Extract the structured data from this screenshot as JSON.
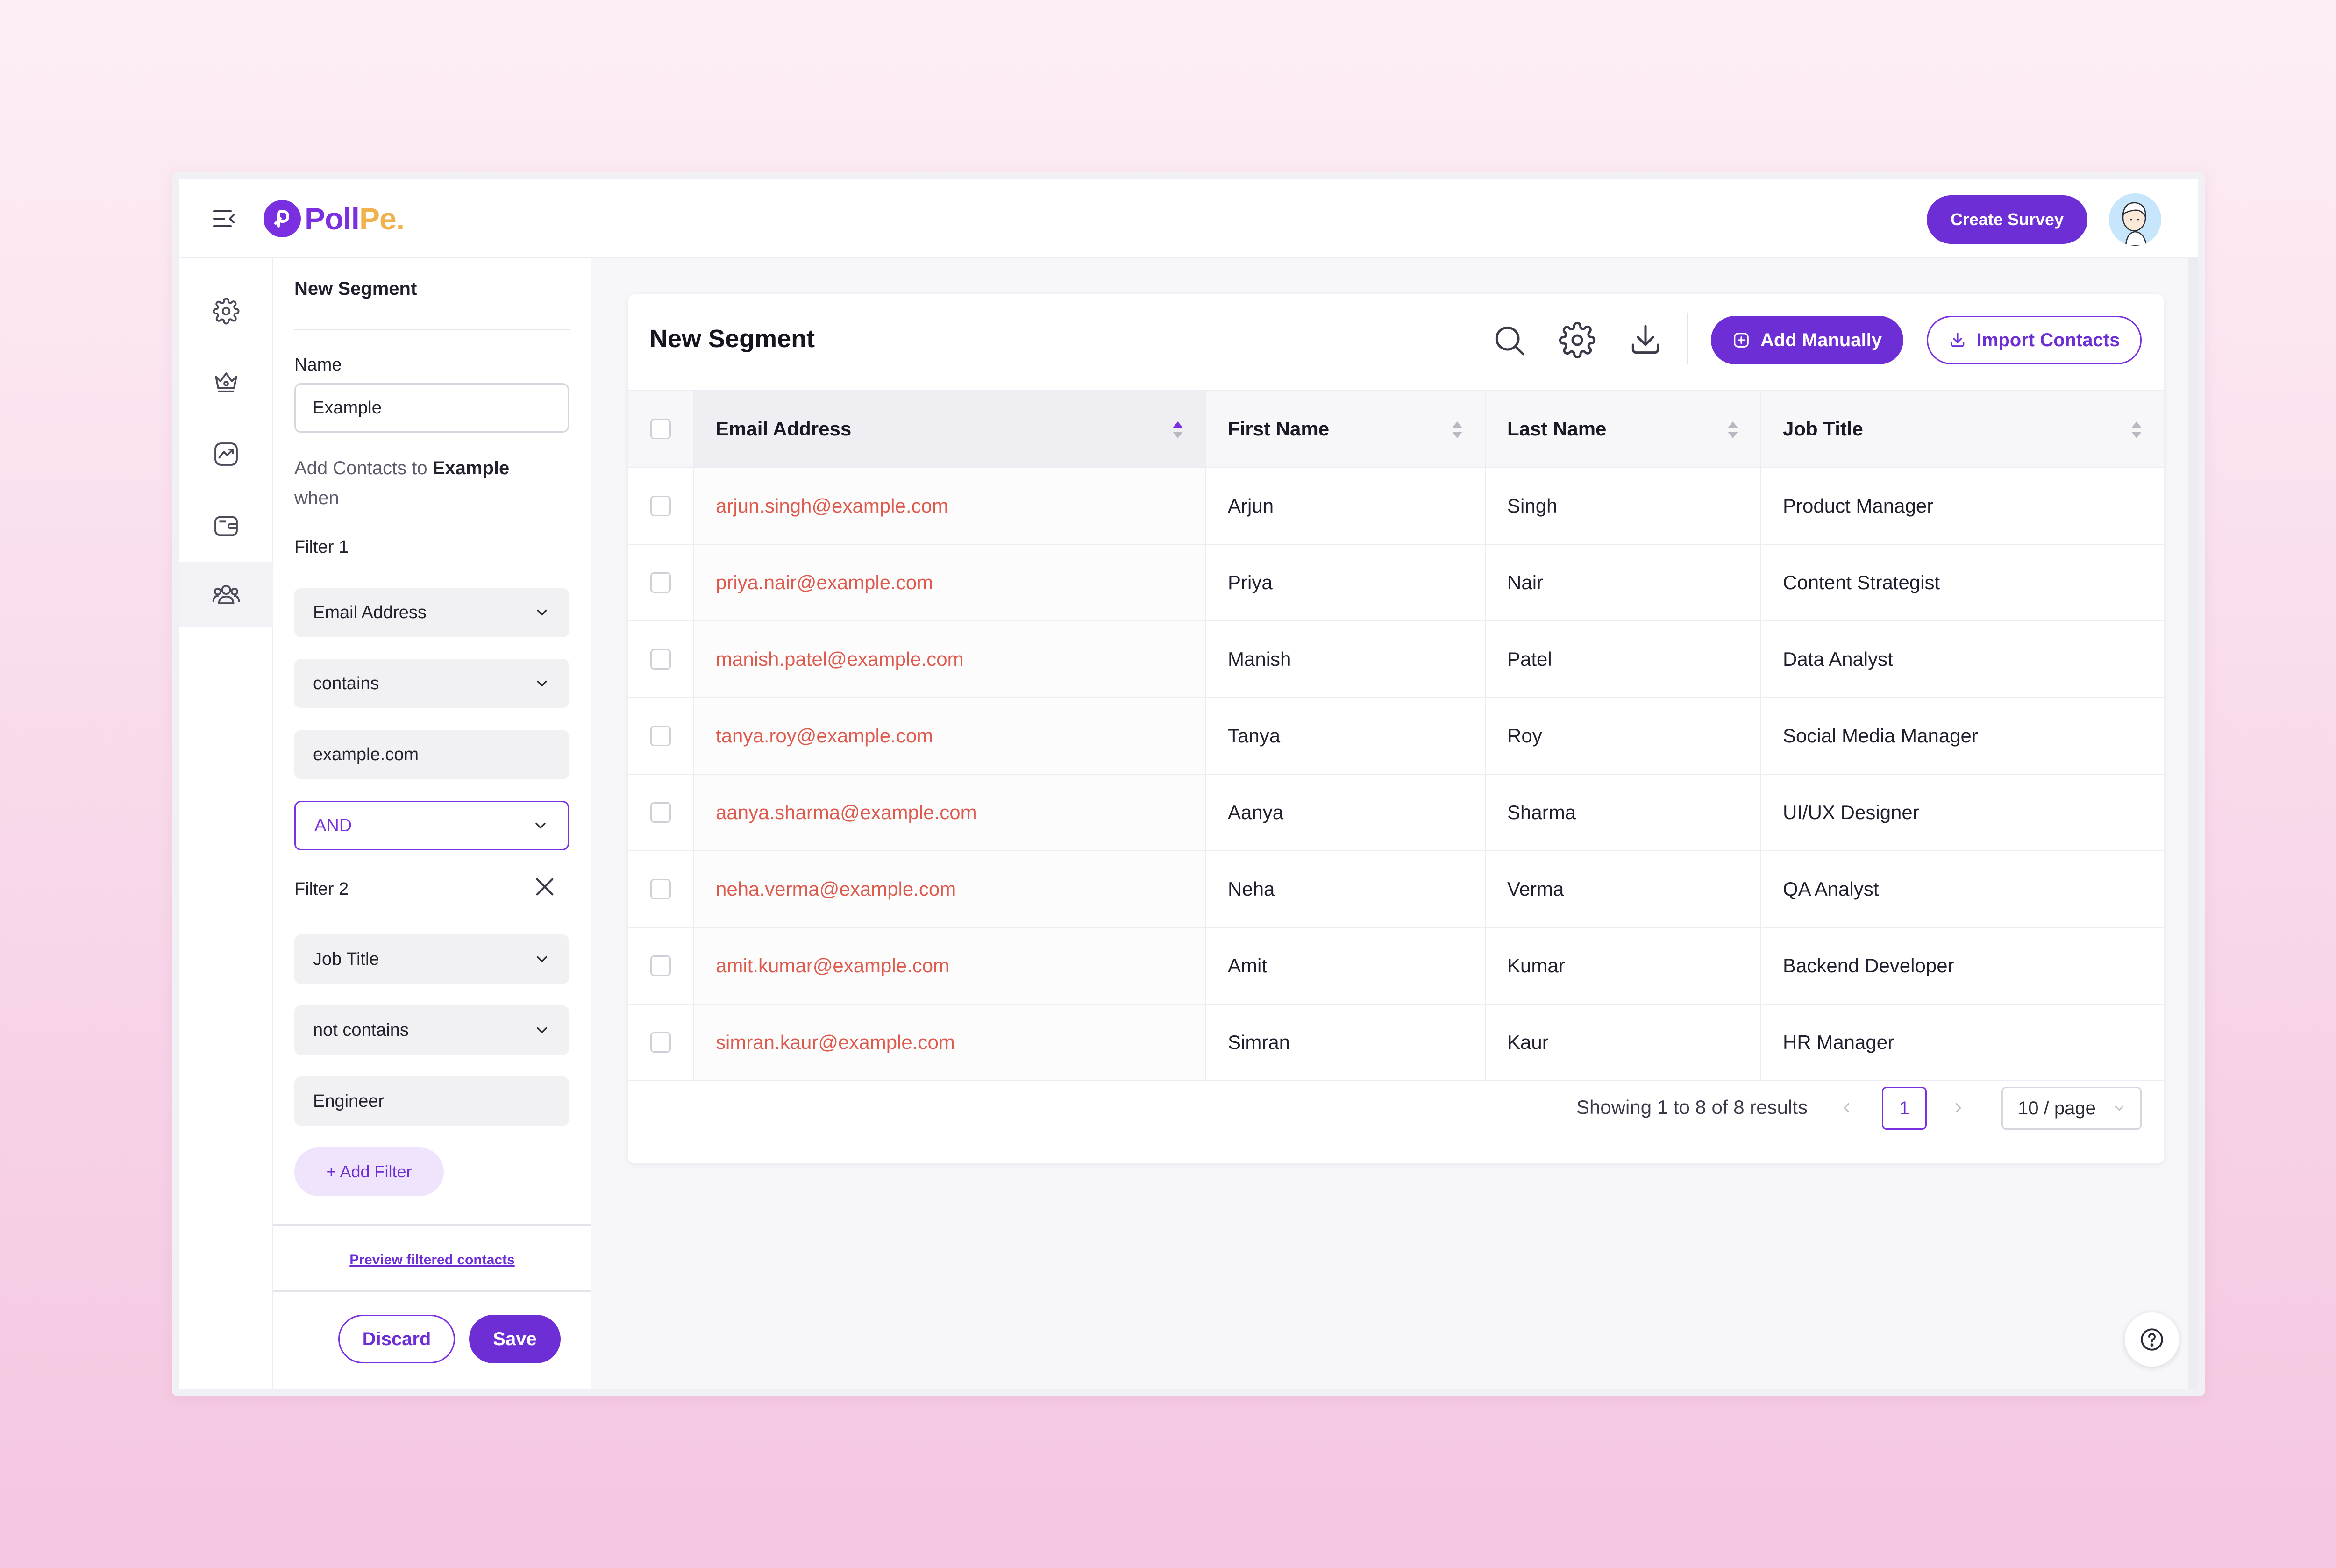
{
  "header": {
    "logo_part1": "Poll",
    "logo_part2": "Pe.",
    "create_survey_label": "Create Survey"
  },
  "rail": {
    "items": [
      "settings-icon",
      "crown-icon",
      "analytics-icon",
      "wallet-icon",
      "contacts-icon"
    ],
    "active": "contacts-icon"
  },
  "panel": {
    "title": "New Segment",
    "name_label": "Name",
    "name_value": "Example",
    "help_prefix": "Add Contacts to",
    "help_target": "Example",
    "help_suffix": "when",
    "filter1": {
      "label": "Filter 1",
      "field": "Email Address",
      "operator": "contains",
      "value": "example.com"
    },
    "conjunction": "AND",
    "filter2": {
      "label": "Filter 2",
      "field": "Job Title",
      "operator": "not contains",
      "value": "Engineer"
    },
    "add_filter_label": "+ Add Filter",
    "preview_label": "Preview filtered contacts",
    "discard_label": "Discard",
    "save_label": "Save"
  },
  "main": {
    "title": "New Segment",
    "add_manually_label": "Add Manually",
    "import_contacts_label": "Import Contacts",
    "columns": [
      "Email Address",
      "First Name",
      "Last Name",
      "Job Title"
    ],
    "rows": [
      [
        "arjun.singh@example.com",
        "Arjun",
        "Singh",
        "Product Manager"
      ],
      [
        "priya.nair@example.com",
        "Priya",
        "Nair",
        "Content Strategist"
      ],
      [
        "manish.patel@example.com",
        "Manish",
        "Patel",
        "Data Analyst"
      ],
      [
        "tanya.roy@example.com",
        "Tanya",
        "Roy",
        "Social Media Manager"
      ],
      [
        "aanya.sharma@example.com",
        "Aanya",
        "Sharma",
        "UI/UX Designer"
      ],
      [
        "neha.verma@example.com",
        "Neha",
        "Verma",
        "QA Analyst"
      ],
      [
        "amit.kumar@example.com",
        "Amit",
        "Kumar",
        "Backend Developer"
      ],
      [
        "simran.kaur@example.com",
        "Simran",
        "Kaur",
        "HR Manager"
      ]
    ],
    "pagination": {
      "summary": "Showing 1 to 8 of 8 results",
      "current_page": "1",
      "prev": "<",
      "next": ">",
      "per_page": "10 / page"
    }
  },
  "colors": {
    "accent": "#6e2ed6",
    "logo_secondary": "#f0b24d",
    "email_link": "#de5a4d"
  }
}
